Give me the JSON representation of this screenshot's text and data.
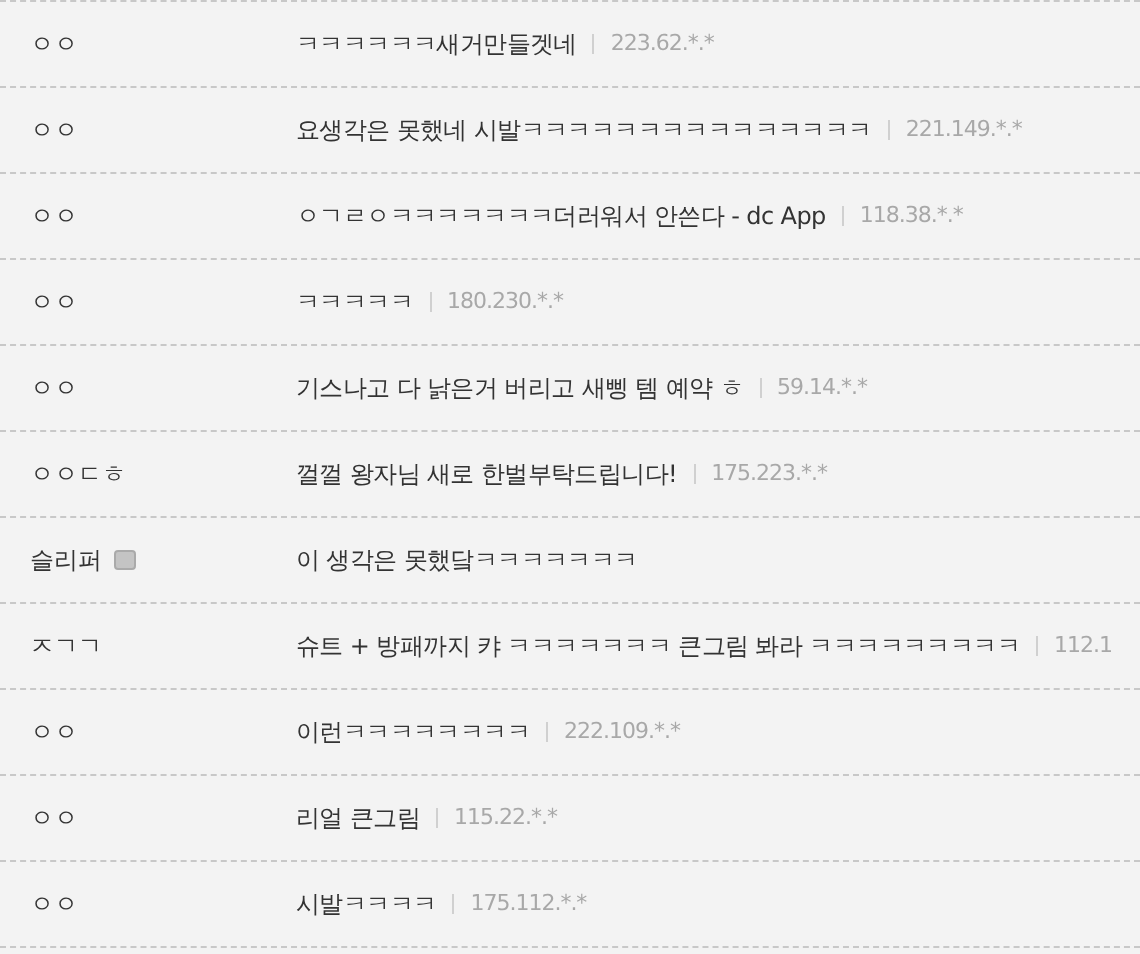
{
  "comments": [
    {
      "nick": "ㅇㅇ",
      "text": "ㅋㅋㅋㅋㅋㅋ새거만들겟네",
      "ip": "223.62.*.*",
      "member": false
    },
    {
      "nick": "ㅇㅇ",
      "text": "요생각은 못했네 시발ㅋㅋㅋㅋㅋㅋㅋㅋㅋㅋㅋㅋㅋㅋㅋ",
      "ip": "221.149.*.*",
      "member": false
    },
    {
      "nick": "ㅇㅇ",
      "text": "ㅇㄱㄹㅇㅋㅋㅋㅋㅋㅋㅋ더러워서 안쓴다 - dc App",
      "ip": "118.38.*.*",
      "member": false
    },
    {
      "nick": "ㅇㅇ",
      "text": "ㅋㅋㅋㅋㅋ",
      "ip": "180.230.*.*",
      "member": false
    },
    {
      "nick": "ㅇㅇ",
      "text": "기스나고 다 낡은거 버리고 새삥 템 예약 ㅎ",
      "ip": "59.14.*.*",
      "member": false
    },
    {
      "nick": "ㅇㅇㄷㅎ",
      "text": "껄껄 왕자님 새로 한벌부탁드립니다!",
      "ip": "175.223.*.*",
      "member": false
    },
    {
      "nick": "슬리퍼",
      "text": "이 생각은 못했닼ㅋㅋㅋㅋㅋㅋㅋ",
      "member": true
    },
    {
      "nick": "ㅈㄱㄱ",
      "text": "슈트 + 방패까지 캬 ㅋㅋㅋㅋㅋㅋㅋ 큰그림 봐라 ㅋㅋㅋㅋㅋㅋㅋㅋㅋ",
      "ip": "112.1",
      "member": false
    },
    {
      "nick": "ㅇㅇ",
      "text": "이런ㅋㅋㅋㅋㅋㅋㅋㅋ",
      "ip": "222.109.*.*",
      "member": false
    },
    {
      "nick": "ㅇㅇ",
      "text": "리얼 큰그림",
      "ip": "115.22.*.*",
      "member": false
    },
    {
      "nick": "ㅇㅇ",
      "text": "시발ㅋㅋㅋㅋ",
      "ip": "175.112.*.*",
      "member": false
    }
  ]
}
